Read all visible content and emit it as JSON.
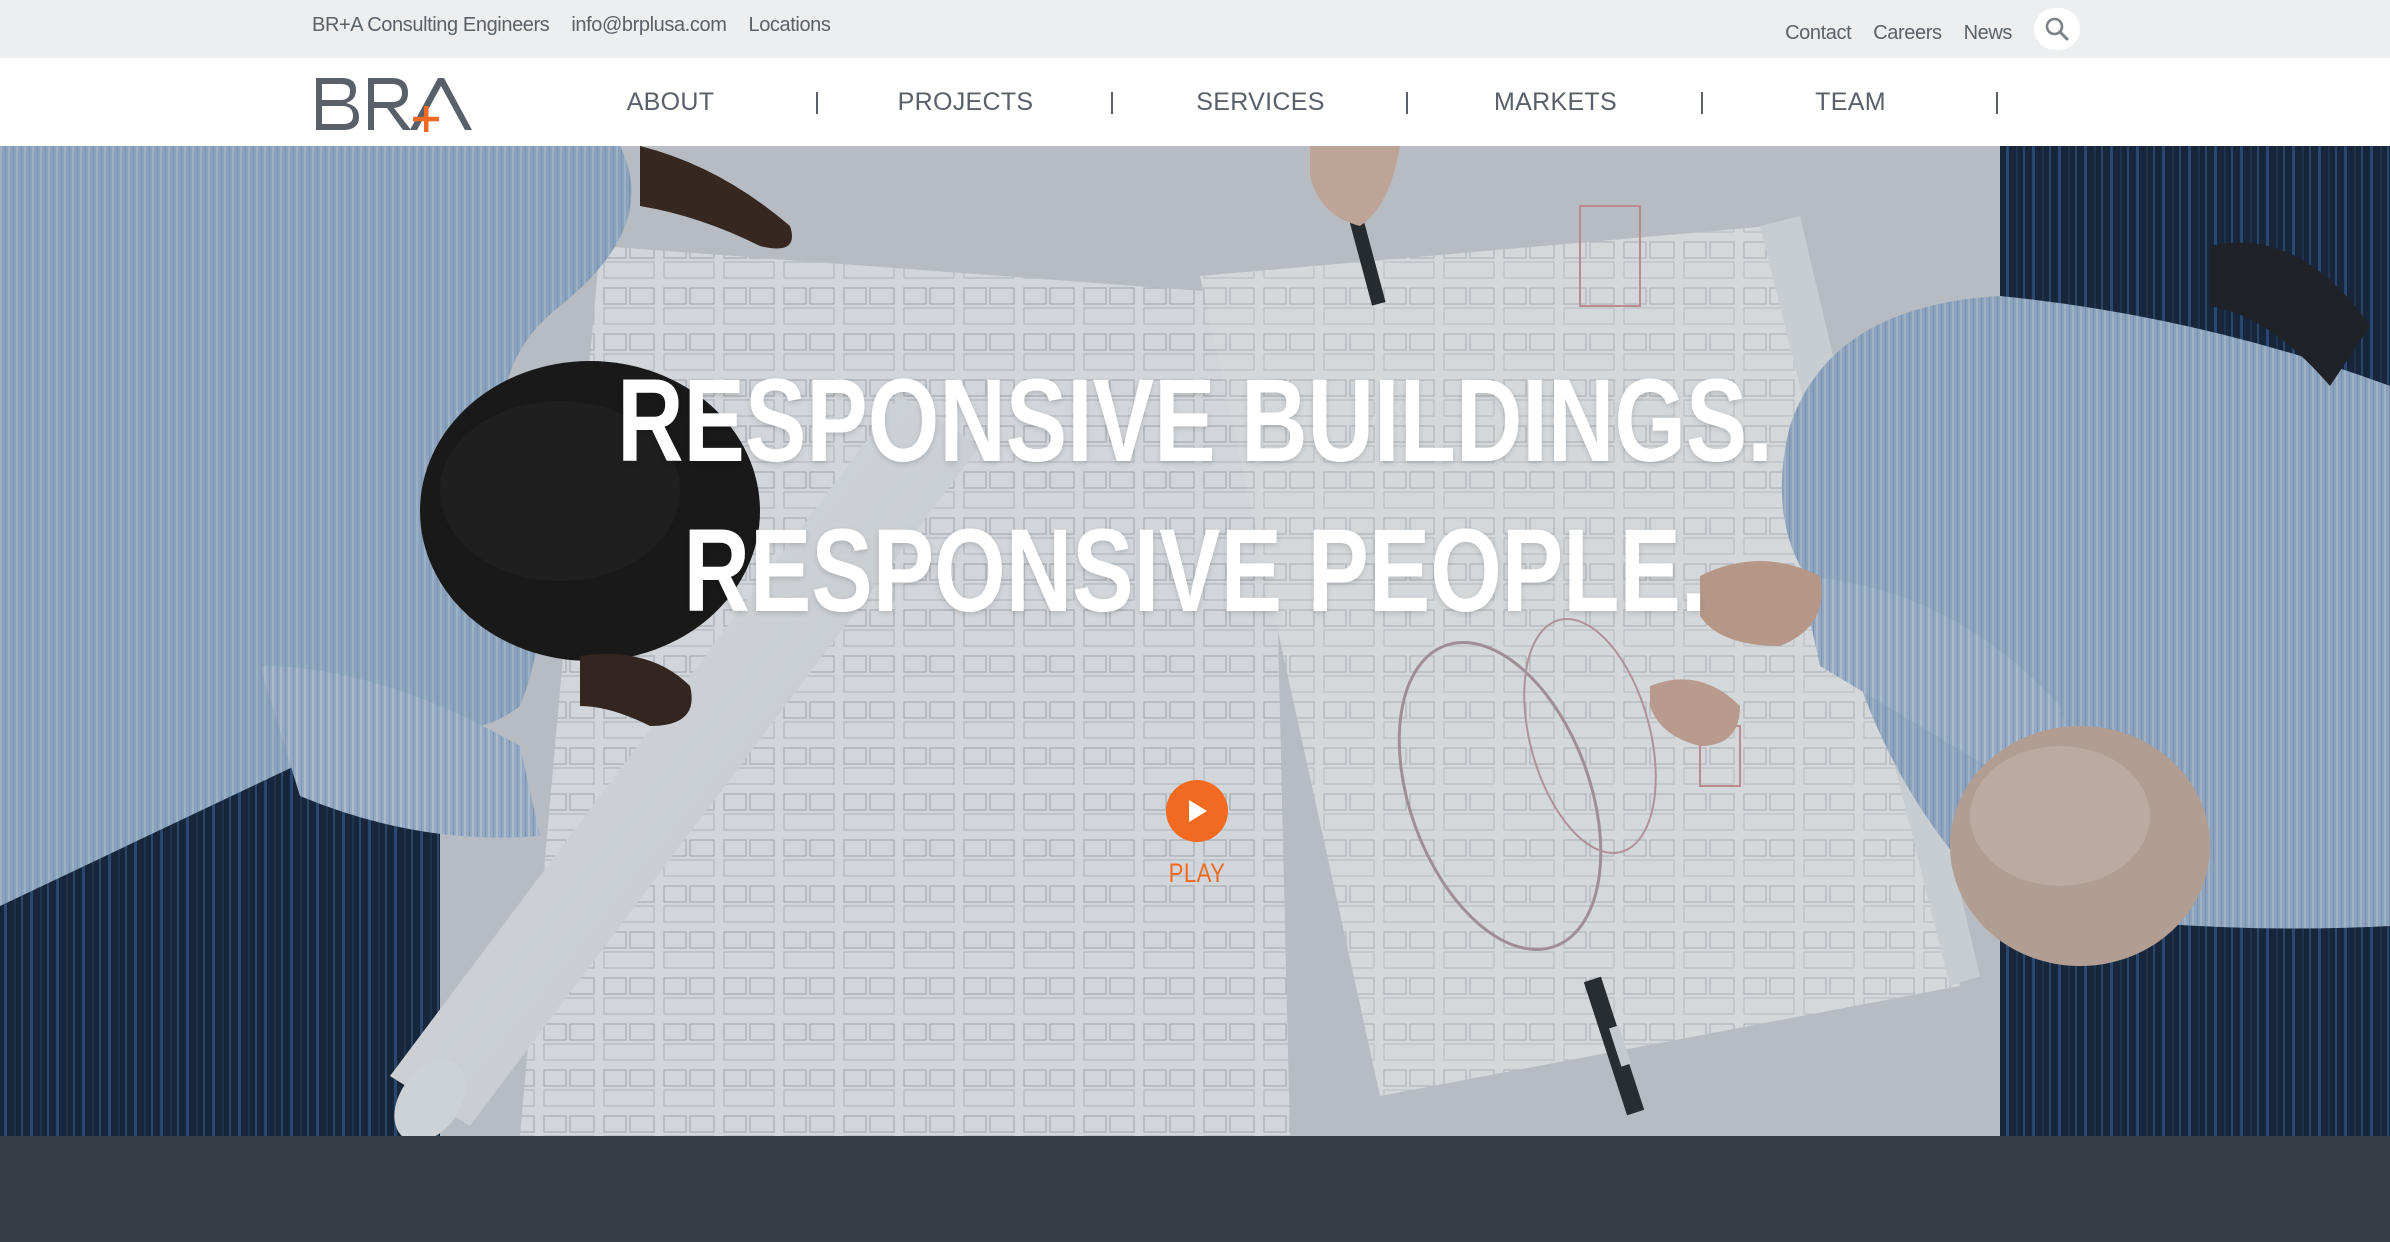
{
  "utility": {
    "company": "BR+A Consulting Engineers",
    "email": "info@brplusa.com",
    "locations": "Locations",
    "contact": "Contact",
    "careers": "Careers",
    "news": "News"
  },
  "logo": {
    "text": "BR+A",
    "brand_color": "#59606a",
    "accent_color": "#f26a21"
  },
  "nav": {
    "items": [
      {
        "label": "ABOUT"
      },
      {
        "label": "PROJECTS"
      },
      {
        "label": "SERVICES"
      },
      {
        "label": "MARKETS"
      },
      {
        "label": "TEAM"
      }
    ]
  },
  "hero": {
    "headline_1": "RESPONSIVE BUILDINGS.",
    "headline_2": "RESPONSIVE PEOPLE.",
    "play_label": "PLAY",
    "play_icon": "play-icon",
    "accent_color": "#f26a21"
  },
  "icons": {
    "search": "search-icon"
  }
}
